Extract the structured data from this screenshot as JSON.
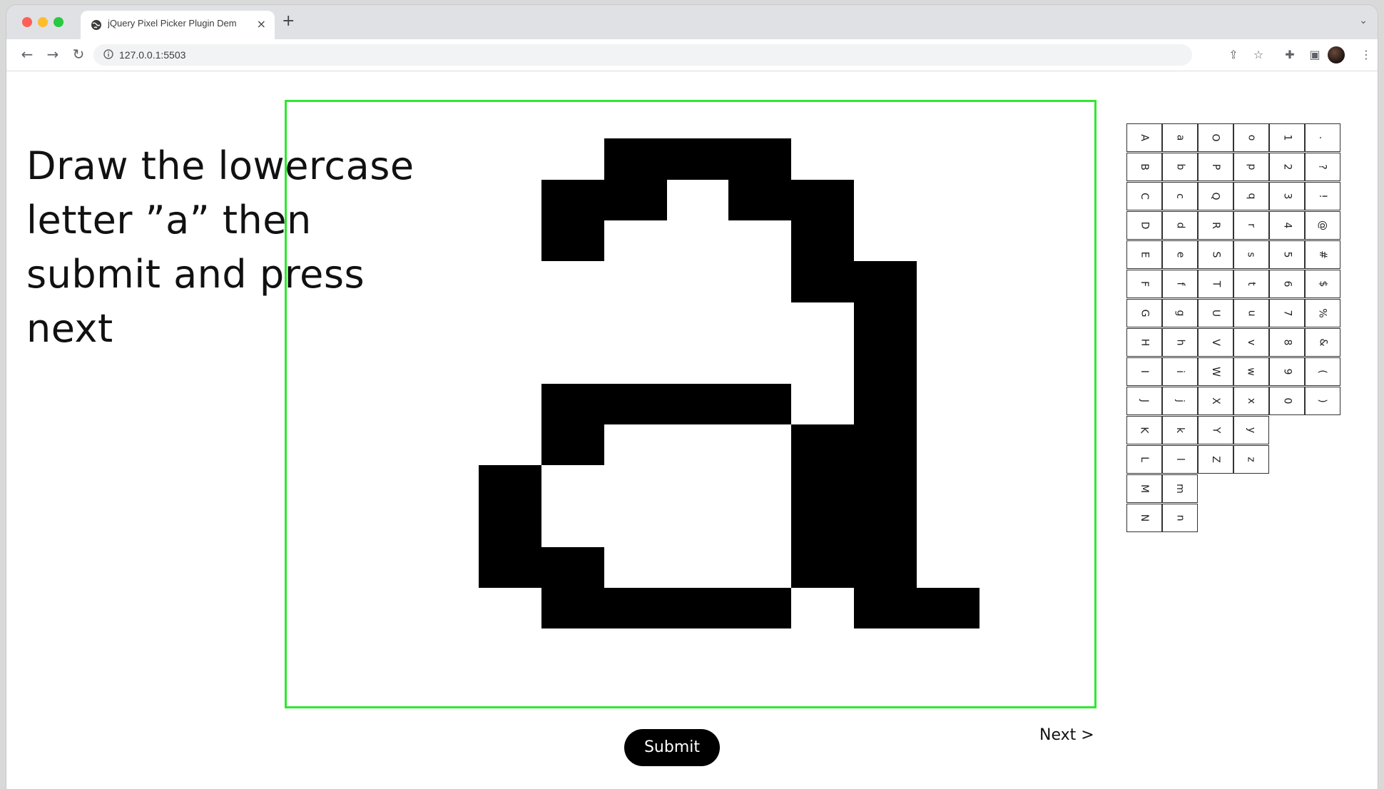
{
  "browser": {
    "tab_title": "jQuery Pixel Picker Plugin Dem",
    "url": "127.0.0.1:5503",
    "new_tab_label": "+",
    "close_label": "×"
  },
  "page": {
    "instruction": "Draw the lowercase letter ”a” then submit and press next",
    "submit_label": "Submit",
    "next_label": "Next >"
  },
  "canvas": {
    "accent_color": "#2ee82e",
    "pixel_color": "#000000",
    "background_color": "#ffffff"
  },
  "glyph_columns": [
    [
      "A",
      "B",
      "C",
      "D",
      "E",
      "F",
      "G",
      "H",
      "I",
      "J",
      "K",
      "L",
      "M",
      "N"
    ],
    [
      "a",
      "b",
      "c",
      "d",
      "e",
      "f",
      "g",
      "h",
      "i",
      "j",
      "k",
      "l",
      "m",
      "n"
    ],
    [
      "O",
      "P",
      "Q",
      "R",
      "S",
      "T",
      "U",
      "V",
      "W",
      "X",
      "Y",
      "Z"
    ],
    [
      "o",
      "p",
      "q",
      "r",
      "s",
      "t",
      "u",
      "v",
      "w",
      "x",
      "y",
      "z"
    ],
    [
      "1",
      "2",
      "3",
      "4",
      "5",
      "6",
      "7",
      "8",
      "9",
      "0"
    ],
    [
      ".",
      "?",
      "!",
      "@",
      "#",
      "$",
      "%",
      "&",
      "(",
      ")"
    ]
  ]
}
